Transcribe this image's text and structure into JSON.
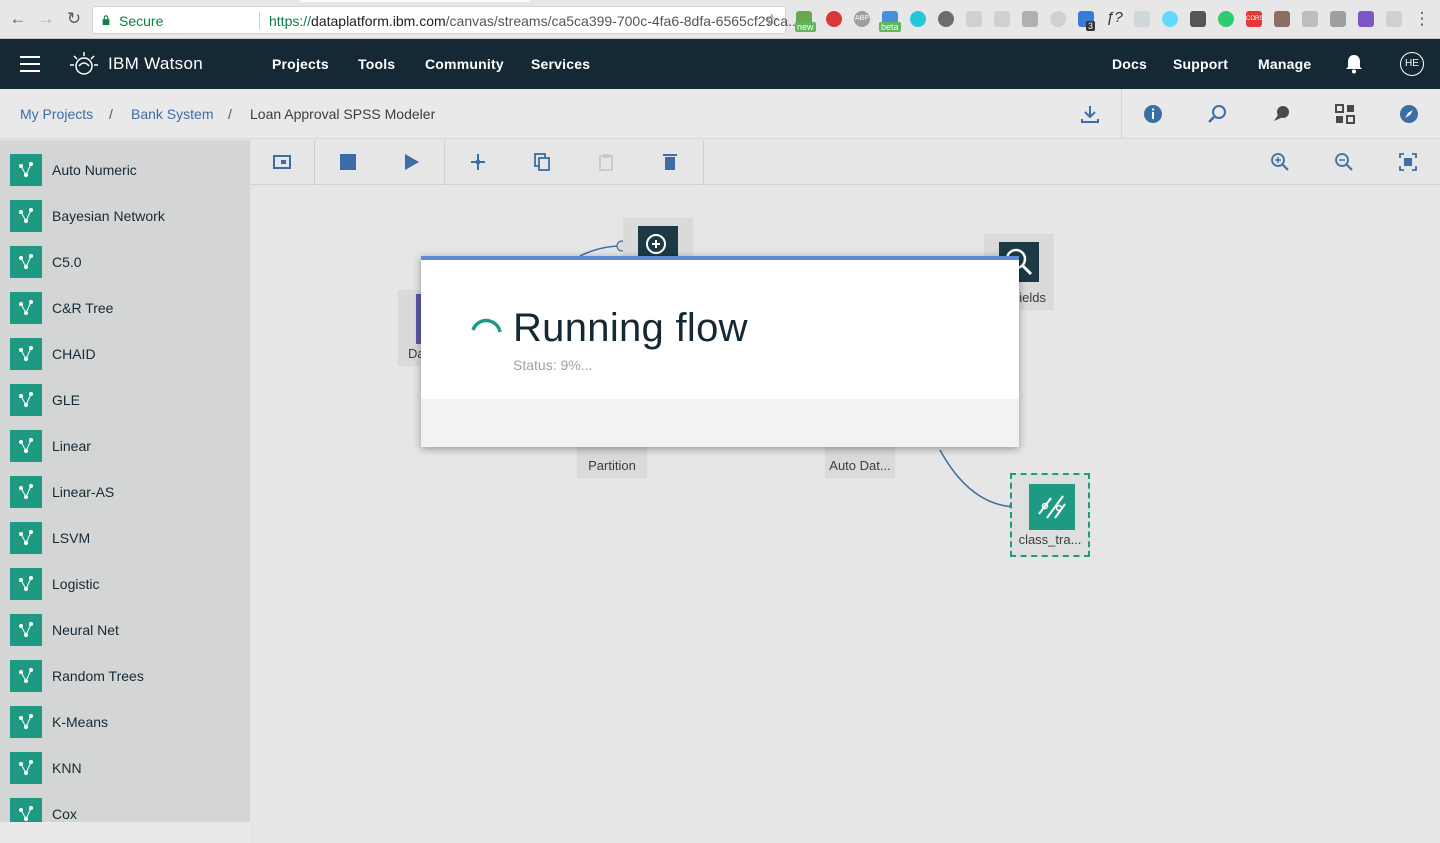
{
  "browser": {
    "secure_label": "Secure",
    "url_scheme": "https://",
    "url_host": "dataplatform.ibm.com",
    "url_path": "/canvas/streams/ca5ca399-700c-4fa6-8dfa-6565cf29ca...",
    "ext_new": "new",
    "ext_beta": "beta",
    "ext_abp": "ABP",
    "ext_count": "3",
    "ext_cors": "CORS",
    "ext_fn": "ƒ?"
  },
  "topbar": {
    "brand": "IBM Watson",
    "nav": [
      "Projects",
      "Tools",
      "Community",
      "Services"
    ],
    "right_nav": [
      "Docs",
      "Support",
      "Manage"
    ],
    "avatar": "HE"
  },
  "breadcrumb": {
    "items": [
      "My Projects",
      "Bank System"
    ],
    "separator": "/",
    "current": "Loan Approval SPSS Modeler"
  },
  "palette": {
    "items": [
      {
        "label": "Auto Numeric",
        "icon": "auto-numeric-icon"
      },
      {
        "label": "Bayesian Network",
        "icon": "bayesian-network-icon"
      },
      {
        "label": "C5.0",
        "icon": "c50-icon"
      },
      {
        "label": "C&R Tree",
        "icon": "cr-tree-icon"
      },
      {
        "label": "CHAID",
        "icon": "chaid-icon"
      },
      {
        "label": "GLE",
        "icon": "gle-icon"
      },
      {
        "label": "Linear",
        "icon": "linear-icon"
      },
      {
        "label": "Linear-AS",
        "icon": "linear-as-icon"
      },
      {
        "label": "LSVM",
        "icon": "lsvm-icon"
      },
      {
        "label": "Logistic",
        "icon": "logistic-icon"
      },
      {
        "label": "Neural Net",
        "icon": "neural-net-icon"
      },
      {
        "label": "Random Trees",
        "icon": "random-trees-icon"
      },
      {
        "label": "K-Means",
        "icon": "k-means-icon"
      },
      {
        "label": "KNN",
        "icon": "knn-icon"
      },
      {
        "label": "Cox",
        "icon": "cox-icon"
      }
    ]
  },
  "canvas": {
    "nodes": {
      "partition": "Partition",
      "auto_data": "Auto Dat...",
      "class_tra": "class_tra...",
      "fields": "ields",
      "data_partial": "Da"
    }
  },
  "dialog": {
    "title": "Running flow",
    "status": "Status: 9%..."
  },
  "colors": {
    "topbar": "#152935",
    "accent": "#1e9a83",
    "link": "#3b6ea5",
    "dialog_topline": "#5a8ad4"
  }
}
